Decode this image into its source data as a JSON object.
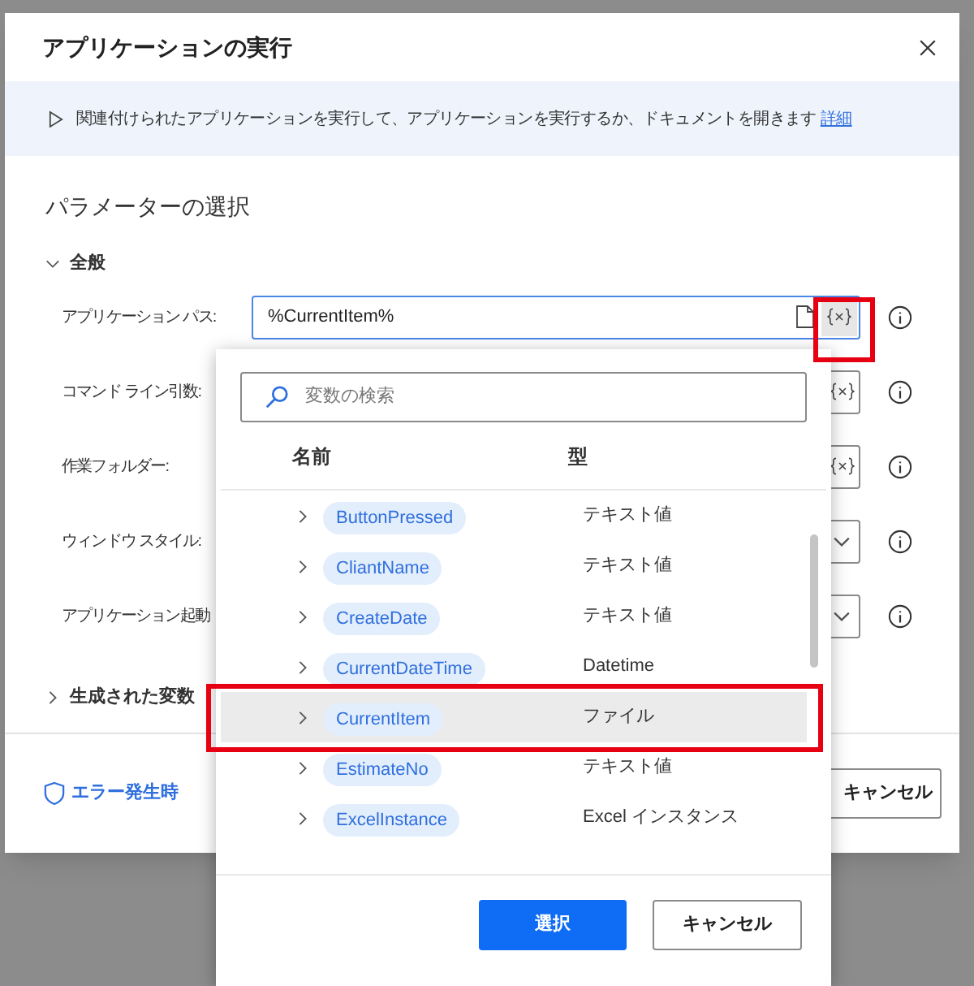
{
  "dialog": {
    "title": "アプリケーションの実行",
    "description": "関連付けられたアプリケーションを実行して、アプリケーションを実行するか、ドキュメントを開きます",
    "details_link": "詳細"
  },
  "section_title": "パラメーターの選択",
  "general_group": {
    "label": "全般",
    "expanded": true
  },
  "parameters": [
    {
      "label": "アプリケーション パス:",
      "value": "%CurrentItem%",
      "kind": "file"
    },
    {
      "label": "コマンド ライン引数:",
      "kind": "text"
    },
    {
      "label": "作業フォルダー:",
      "kind": "text"
    },
    {
      "label": "ウィンドウ スタイル:",
      "kind": "dropdown"
    },
    {
      "label": "アプリケーション起動",
      "kind": "dropdown"
    }
  ],
  "variables_group": {
    "label": "生成された変数",
    "expanded": false
  },
  "footer": {
    "error_link": "エラー発生時",
    "cancel": "キャンセル"
  },
  "variable_picker": {
    "search_placeholder": "変数の検索",
    "columns": [
      "名前",
      "型"
    ],
    "rows": [
      {
        "name": "ButtonPressed",
        "type": "テキスト値",
        "selected": false
      },
      {
        "name": "CliantName",
        "type": "テキスト値",
        "selected": false
      },
      {
        "name": "CreateDate",
        "type": "テキスト値",
        "selected": false
      },
      {
        "name": "CurrentDateTime",
        "type": "Datetime",
        "selected": false
      },
      {
        "name": "CurrentItem",
        "type": "ファイル",
        "selected": true
      },
      {
        "name": "EstimateNo",
        "type": "テキスト値",
        "selected": false
      },
      {
        "name": "ExcelInstance",
        "type": "Excel インスタンス",
        "selected": false
      }
    ],
    "buttons": [
      "選択",
      "キャンセル"
    ]
  }
}
